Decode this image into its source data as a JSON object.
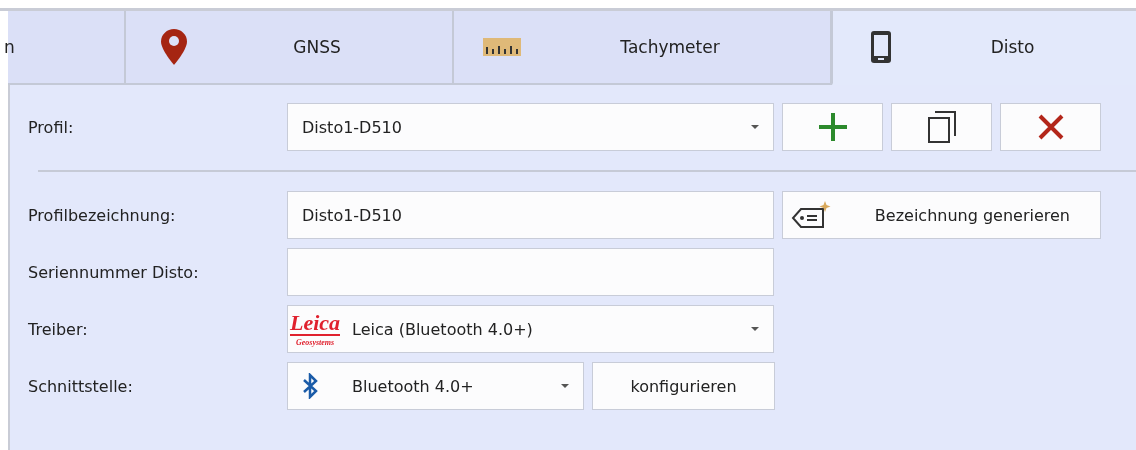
{
  "tabs": [
    {
      "label": "n",
      "selected": false
    },
    {
      "label": "GNSS",
      "selected": false
    },
    {
      "label": "Tachymeter",
      "selected": false
    },
    {
      "label": "Disto",
      "selected": true
    }
  ],
  "profile": {
    "label": "Profil:",
    "value": "Disto1-D510"
  },
  "rows": [
    {
      "label": "Profilbezeichnung:",
      "kind": "input",
      "value": "Disto1-D510",
      "button": "Bezeichnung generieren"
    },
    {
      "label": "Seriennummer Disto:",
      "kind": "input"
    },
    {
      "label": "Treiber:",
      "kind": "dropdown",
      "value": "Leica (Bluetooth 4.0+)",
      "logo": {
        "name": "Leica",
        "sub": "Geosystems"
      }
    },
    {
      "label": "Schnittstelle:",
      "kind": "dropdown",
      "value": "Bluetooth 4.0+",
      "button": "konfigurieren"
    }
  ]
}
